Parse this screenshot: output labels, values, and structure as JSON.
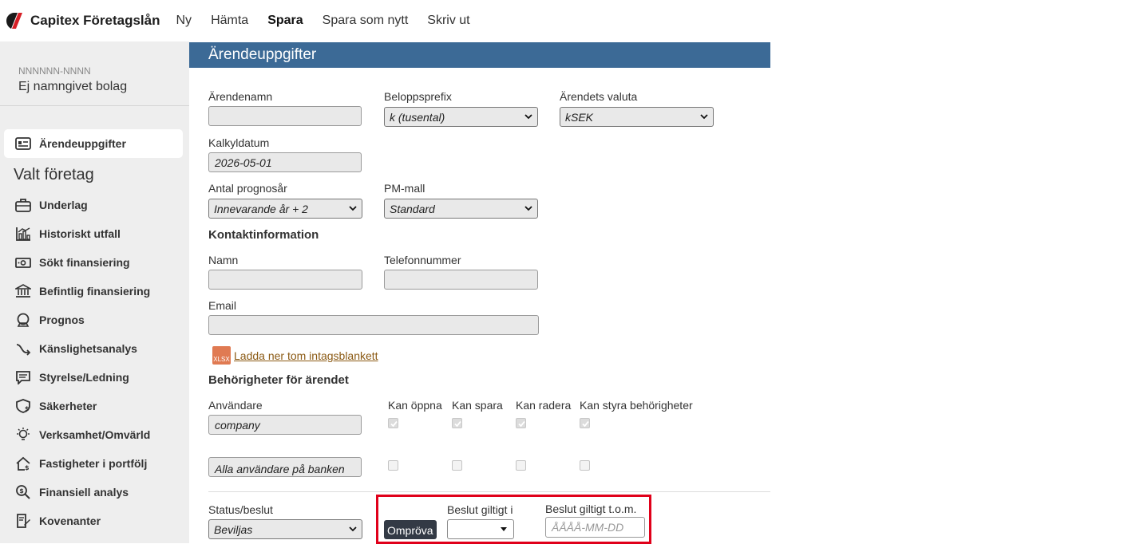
{
  "app": {
    "title": "Capitex Företagslån"
  },
  "topnav": {
    "items": [
      "Ny",
      "Hämta",
      "Spara",
      "Spara som nytt",
      "Skriv ut"
    ]
  },
  "sidebar": {
    "company_id": "NNNNNN-NNNN",
    "company_name": "Ej namngivet bolag",
    "active_item": {
      "label": "Ärendeuppgifter",
      "icon": "id-card-icon"
    },
    "section_heading": "Valt företag",
    "items": [
      {
        "label": "Underlag",
        "icon": "briefcase-icon"
      },
      {
        "label": "Historiskt utfall",
        "icon": "bar-chart-icon"
      },
      {
        "label": "Sökt finansiering",
        "icon": "banknote-icon"
      },
      {
        "label": "Befintlig finansiering",
        "icon": "bank-icon"
      },
      {
        "label": "Prognos",
        "icon": "crystal-ball-icon"
      },
      {
        "label": "Känslighetsanalys",
        "icon": "curved-arrow-icon"
      },
      {
        "label": "Styrelse/Ledning",
        "icon": "message-icon"
      },
      {
        "label": "Säkerheter",
        "icon": "shield-dollar-icon"
      },
      {
        "label": "Verksamhet/Omvärld",
        "icon": "lightbulb-icon"
      },
      {
        "label": "Fastigheter i portfölj",
        "icon": "house-icon"
      },
      {
        "label": "Finansiell analys",
        "icon": "magnifier-dollar-icon"
      },
      {
        "label": "Kovenanter",
        "icon": "document-pen-icon"
      }
    ]
  },
  "panel": {
    "title": "Ärendeuppgifter",
    "arendenamn": {
      "label": "Ärendenamn",
      "value": ""
    },
    "beloppsprefix": {
      "label": "Beloppsprefix",
      "value": "k (tusental)"
    },
    "valuta": {
      "label": "Ärendets valuta",
      "value": "kSEK"
    },
    "kalkyldatum": {
      "label": "Kalkyldatum",
      "value": "2026-05-01"
    },
    "prognosar": {
      "label": "Antal prognosår",
      "value": "Innevarande år + 2"
    },
    "pm_mall": {
      "label": "PM-mall",
      "value": "Standard"
    },
    "kontakt_title": "Kontaktinformation",
    "namn": {
      "label": "Namn",
      "value": ""
    },
    "telefon": {
      "label": "Telefonnummer",
      "value": ""
    },
    "email": {
      "label": "Email",
      "value": ""
    },
    "xlsx_badge": "XLSX",
    "download_link": "Ladda ner tom intagsblankett",
    "permissions": {
      "title": "Behörigheter för ärendet",
      "user_label": "Användare",
      "columns": [
        "Kan öppna",
        "Kan spara",
        "Kan radera",
        "Kan styra behörigheter"
      ],
      "rows": [
        {
          "user": "company",
          "checks": [
            true,
            true,
            true,
            true
          ]
        },
        {
          "user": "Alla användare på banken",
          "checks": [
            false,
            false,
            false,
            false
          ]
        }
      ]
    },
    "status": {
      "label": "Status/beslut",
      "value": "Beviljas"
    },
    "ompova_button": "Ompröva",
    "beslut_giltigt_i": {
      "label": "Beslut giltigt i",
      "value": ""
    },
    "beslut_tom": {
      "label": "Beslut giltigt t.o.m.",
      "placeholder": "ÅÅÅÅ-MM-DD"
    }
  },
  "colors": {
    "header": "#3c6a96",
    "highlight": "#e0001a",
    "link": "#8b5a14",
    "button": "#333a45"
  }
}
